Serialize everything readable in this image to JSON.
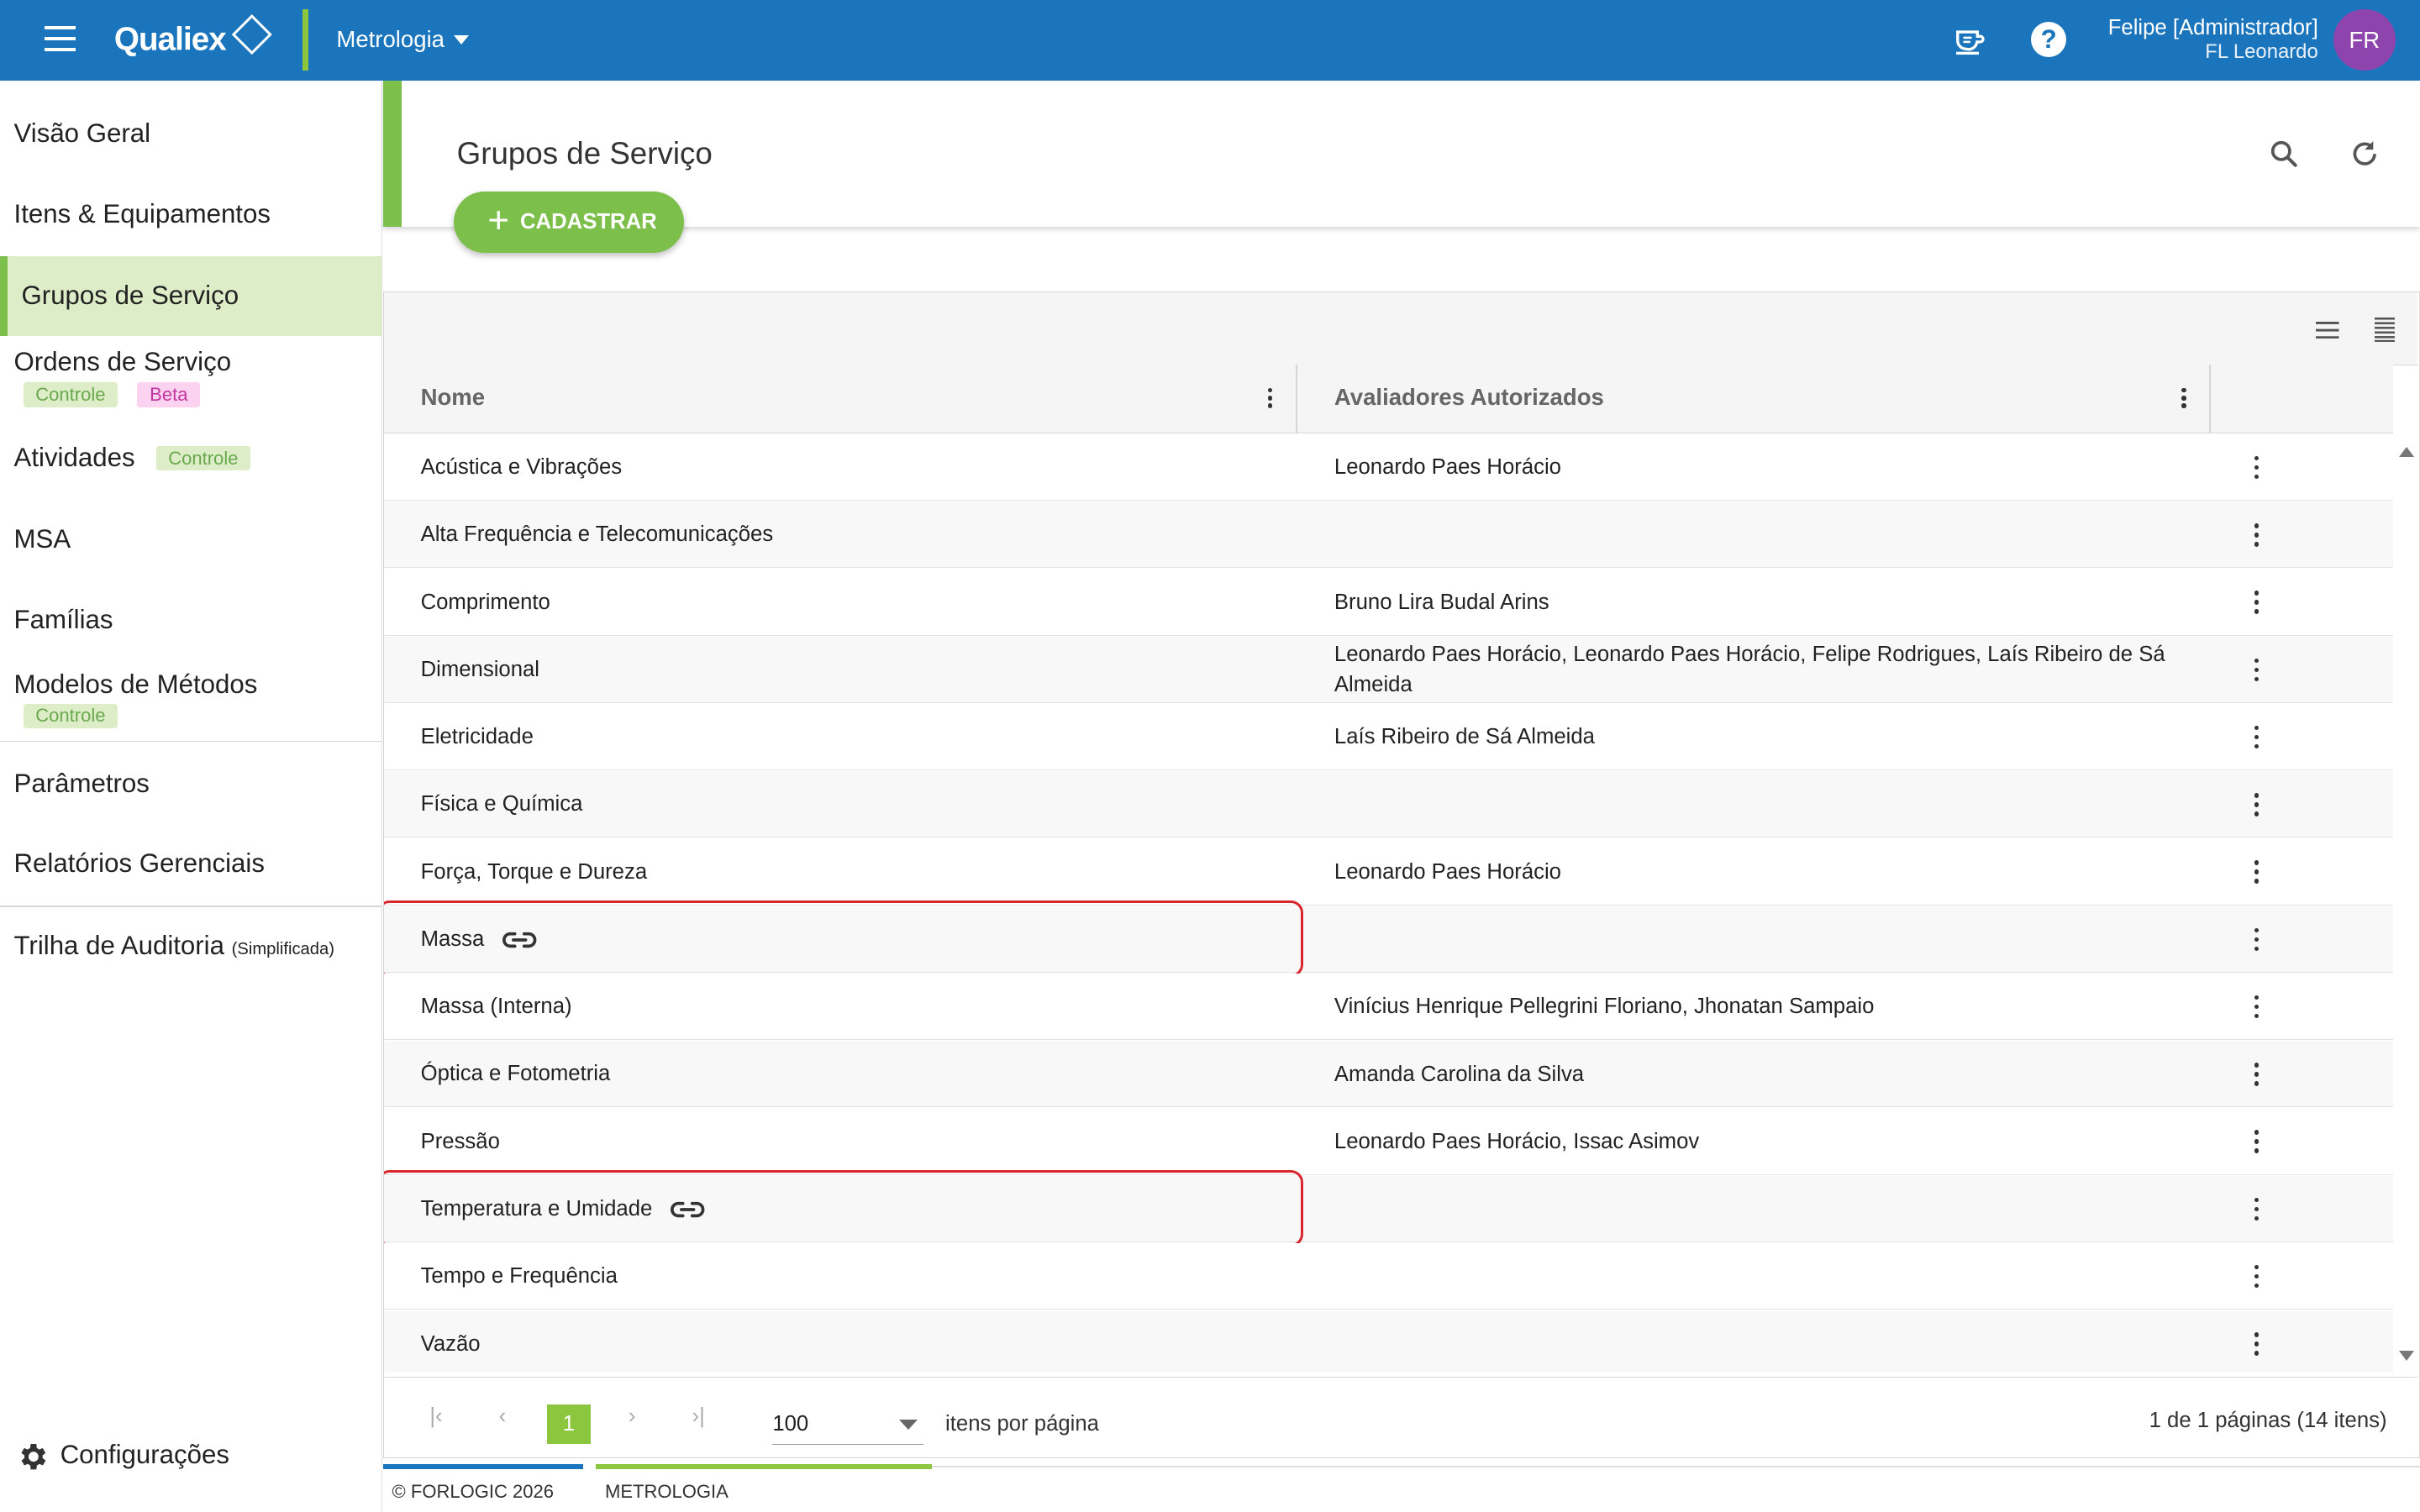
{
  "topbar": {
    "logo": "Qualiex",
    "module": "Metrologia",
    "user_name": "Felipe [Administrador]",
    "user_company": "FL Leonardo",
    "avatar_initials": "FR",
    "colors": {
      "primary": "#1b75bc",
      "accent": "#8cc63f",
      "avatar": "#8e44ad"
    }
  },
  "sidebar": {
    "items": [
      {
        "label": "Visão Geral"
      },
      {
        "label": "Itens & Equipamentos"
      },
      {
        "label": "Grupos de Serviço",
        "active": true
      },
      {
        "label": "Ordens de Serviço",
        "badges": [
          "Controle",
          "Beta"
        ]
      },
      {
        "label": "Atividades",
        "badges": [
          "Controle"
        ]
      },
      {
        "label": "MSA"
      },
      {
        "label": "Famílias"
      },
      {
        "label": "Modelos de Métodos",
        "badges": [
          "Controle"
        ]
      },
      {
        "label": "Parâmetros"
      },
      {
        "label": "Relatórios Gerenciais"
      },
      {
        "label": "Trilha de Auditoria",
        "suffix": "(Simplificada)"
      }
    ],
    "settings_label": "Configurações"
  },
  "page": {
    "title": "Grupos de Serviço",
    "add_button": "CADASTRAR"
  },
  "table": {
    "columns": [
      "Nome",
      "Avaliadores Autorizados"
    ],
    "rows": [
      {
        "name": "Acústica e Vibrações",
        "evaluators": "Leonardo Paes Horácio"
      },
      {
        "name": "Alta Frequência e Telecomunicações",
        "evaluators": ""
      },
      {
        "name": "Comprimento",
        "evaluators": "Bruno Lira Budal Arins"
      },
      {
        "name": "Dimensional",
        "evaluators": "Leonardo Paes Horácio, Leonardo Paes Horácio, Felipe Rodrigues, Laís Ribeiro de Sá Almeida"
      },
      {
        "name": "Eletricidade",
        "evaluators": "Laís Ribeiro de Sá Almeida"
      },
      {
        "name": "Física e Química",
        "evaluators": ""
      },
      {
        "name": "Força, Torque e Dureza",
        "evaluators": "Leonardo Paes Horácio"
      },
      {
        "name": "Massa",
        "evaluators": "",
        "linked": true,
        "highlighted": true
      },
      {
        "name": "Massa (Interna)",
        "evaluators": "Vinícius Henrique Pellegrini Floriano, Jhonatan Sampaio"
      },
      {
        "name": "Óptica e Fotometria",
        "evaluators": "Amanda Carolina da Silva"
      },
      {
        "name": "Pressão",
        "evaluators": "Leonardo Paes Horácio, Issac Asimov"
      },
      {
        "name": "Temperatura e Umidade",
        "evaluators": "",
        "linked": true,
        "highlighted": true
      },
      {
        "name": "Tempo e Frequência",
        "evaluators": ""
      },
      {
        "name": "Vazão",
        "evaluators": ""
      }
    ]
  },
  "pagination": {
    "current_page": "1",
    "page_size": "100",
    "per_page_label": "itens por página",
    "info": "1 de 1 páginas (14 itens)"
  },
  "footer": {
    "copyright": "© FORLOGIC 2026",
    "module": "METROLOGIA"
  }
}
